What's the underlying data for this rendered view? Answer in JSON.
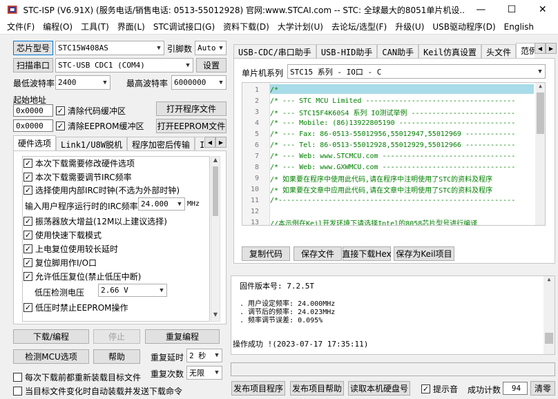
{
  "window": {
    "title": "STC-ISP (V6.91X) (服务电话/销售电话: 0513-55012928) 官网:www.STCAI.com  -- STC: 全球最大的8051单片机设...",
    "minimize": "—",
    "maximize": "☐",
    "close": "✕"
  },
  "menu": [
    "文件(F)",
    "编程(O)",
    "工具(T)",
    "界面(L)",
    "STC调试接口(G)",
    "资料下载(D)",
    "大学计划(U)",
    "去论坛/选型(F)",
    "升级(U)",
    "USB驱动程序(D)",
    "English"
  ],
  "left": {
    "mcu_type_btn": "芯片型号",
    "mcu_type_value": "STC15W408AS",
    "pin_label": "引脚数",
    "pin_value": "Auto",
    "scan_btn": "扫描串口",
    "port_value": "STC-USB CDC1 (COM4)",
    "settings_btn": "设置",
    "min_baud_label": "最低波特率",
    "min_baud_value": "2400",
    "max_baud_label": "最高波特率",
    "max_baud_value": "6000000",
    "start_addr_label": "起始地址",
    "addr1": "0x0000",
    "clear_code_label": "清除代码缓冲区",
    "open_prog_btn": "打开程序文件",
    "addr2": "0x0000",
    "clear_eeprom_label": "清除EEPROM缓冲区",
    "open_eeprom_btn": "打开EEPROM文件",
    "tabs": [
      "硬件选项",
      "Link1/U8W脱机",
      "程序加密后传输",
      "ID号"
    ],
    "options": [
      {
        "label": "本次下载需要修改硬件选项",
        "checked": true
      },
      {
        "label": "本次下载需要调节IRC频率",
        "checked": true
      },
      {
        "label": "选择使用内部IRC时钟(不选为外部时钟)",
        "checked": true
      }
    ],
    "irc_label": "输入用户程序运行时的IRC频率",
    "irc_value": "24.000",
    "irc_unit": "MHz",
    "options2": [
      {
        "label": "振荡器放大增益(12M以上建议选择)",
        "checked": true
      },
      {
        "label": "使用快速下载模式",
        "checked": true
      },
      {
        "label": "上电复位使用较长延时",
        "checked": true
      },
      {
        "label": "复位脚用作I/O口",
        "checked": true
      },
      {
        "label": "允许低压复位(禁止低压中断)",
        "checked": true
      }
    ],
    "lv_label": "低压检测电压",
    "lv_value": "2.66 V",
    "option_last": {
      "label": "低压时禁止EEPROM操作",
      "checked": true
    },
    "download_btn": "下载/编程",
    "stop_btn": "停止",
    "reprogram_btn": "重复编程",
    "check_mcu_btn": "检测MCU选项",
    "help_btn": "帮助",
    "repeat_delay_label": "重复延时",
    "repeat_delay_value": "2 秒",
    "repeat_count_label": "重复次数",
    "repeat_count_value": "无限",
    "reload_label": "每次下载前都重新装载目标文件",
    "auto_load_label": "当目标文件变化时自动装载并发送下载命令"
  },
  "right": {
    "tabs": [
      "USB-CDC/串口助手",
      "USB-HID助手",
      "CAN助手",
      "Keil仿真设置",
      "头文件",
      "范例程序"
    ],
    "series_label": "单片机系列",
    "series_value": "STC15 系列 - IO口 - C",
    "code_lines": [
      {
        "n": "1",
        "t": "/*"
      },
      {
        "n": "2",
        "t": "/* --- STC MCU Limited ------------------------------------"
      },
      {
        "n": "3",
        "t": "/* --- STC15F4K60S4 系列 IO测试举例 -------------------------"
      },
      {
        "n": "4",
        "t": "/* --- Mobile: (86)13922805190 ----------------------------"
      },
      {
        "n": "5",
        "t": "/* --- Fax: 86-0513-55012956,55012947,55012969 ------------"
      },
      {
        "n": "6",
        "t": "/* --- Tel: 86-0513-55012928,55012929,55012966 ------------"
      },
      {
        "n": "7",
        "t": "/* --- Web: www.STCMCU.com --------------------------------"
      },
      {
        "n": "8",
        "t": "/* --- Web: www.GXWMCU.com --------------------------------"
      },
      {
        "n": "9",
        "t": "/* 如果要在程序中使用此代码,请在程序中注明使用了STC的资料及程序"
      },
      {
        "n": "10",
        "t": "/* 如果要在文章中应用此代码,请在文章中注明使用了STC的资料及程序"
      },
      {
        "n": "11",
        "t": "/*---------------------------------------------------------"
      },
      {
        "n": "12",
        "t": ""
      },
      {
        "n": "13",
        "t": "//本示例在Keil开发环境下请选择Intel的8058芯片型号进行编译"
      }
    ],
    "copy_btn": "复制代码",
    "save_btn": "保存文件",
    "direct_btn": "直接下载Hex",
    "save_keil_btn": "保存为Keil项目",
    "log": {
      "fw": "固件版本号: 7.2.5T",
      "l1": ". 用户设定频率: 24.000MHz",
      "l2": ". 调节后的频率: 24.023MHz",
      "l3": ". 频率调节误差: 0.095%",
      "result": "操作成功 !(2023-07-17 17:35:11)"
    },
    "publish_btn": "发布项目程序",
    "publish_help_btn": "发布项目帮助",
    "read_disk_btn": "读取本机硬盘号",
    "beep_label": "提示音",
    "count_label": "成功计数",
    "count_value": "94",
    "clear_btn": "清零"
  }
}
